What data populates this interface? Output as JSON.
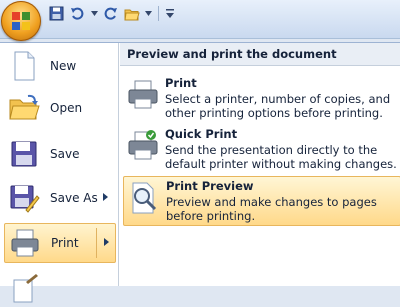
{
  "quick_access": {
    "icons": [
      "save-icon",
      "undo-icon",
      "dropdown-icon",
      "redo-icon",
      "open-folder-icon",
      "customize-icon"
    ]
  },
  "left_menu": {
    "items": [
      {
        "label": "New",
        "icon": "new-document-icon"
      },
      {
        "label": "Open",
        "icon": "open-folder-icon"
      },
      {
        "label": "Save",
        "icon": "floppy-disk-icon"
      },
      {
        "label": "Save As",
        "icon": "save-as-icon"
      },
      {
        "label": "Print",
        "icon": "printer-icon",
        "active": true
      },
      {
        "label": "",
        "icon": "prepare-icon"
      }
    ]
  },
  "right_pane": {
    "header": "Preview and print the document",
    "items": [
      {
        "title": "Print",
        "description": "Select a printer, number of copies, and other printing options before printing.",
        "icon": "printer-icon"
      },
      {
        "title": "Quick Print",
        "description": "Send the presentation directly to the default printer without making changes.",
        "icon": "quick-print-icon"
      },
      {
        "title": "Print Preview",
        "description": "Preview and make changes to pages before printing.",
        "icon": "print-preview-icon",
        "active": true
      }
    ]
  },
  "colors": {
    "accent": "#ffd98a",
    "header_bg": "#e9eef5",
    "office_orange": "#f0a020"
  }
}
